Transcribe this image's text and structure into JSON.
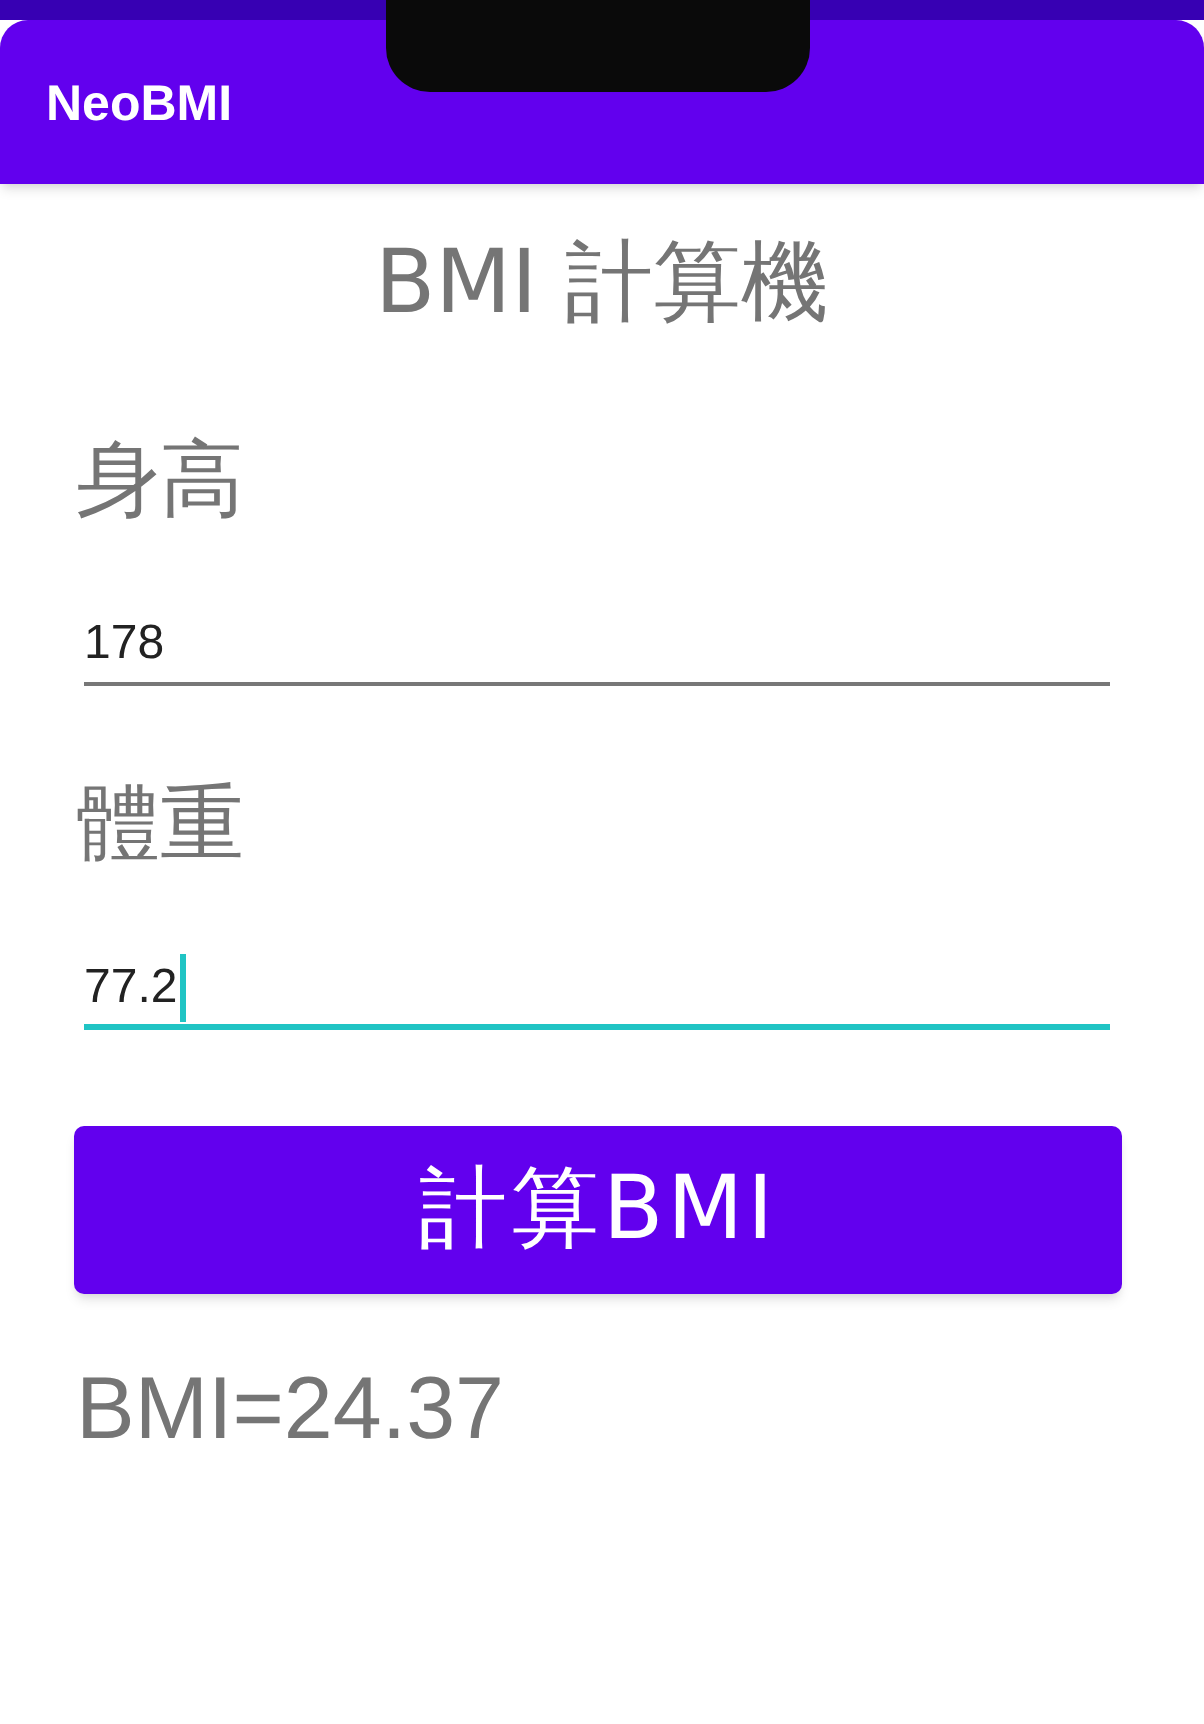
{
  "app_bar": {
    "title": "NeoBMI"
  },
  "heading": "BMI 計算機",
  "fields": [
    {
      "label": "身高",
      "value": "178",
      "focused": false
    },
    {
      "label": "體重",
      "value": "77.2",
      "focused": true
    }
  ],
  "button": {
    "label": "計算BMI"
  },
  "result": "BMI=24.37"
}
